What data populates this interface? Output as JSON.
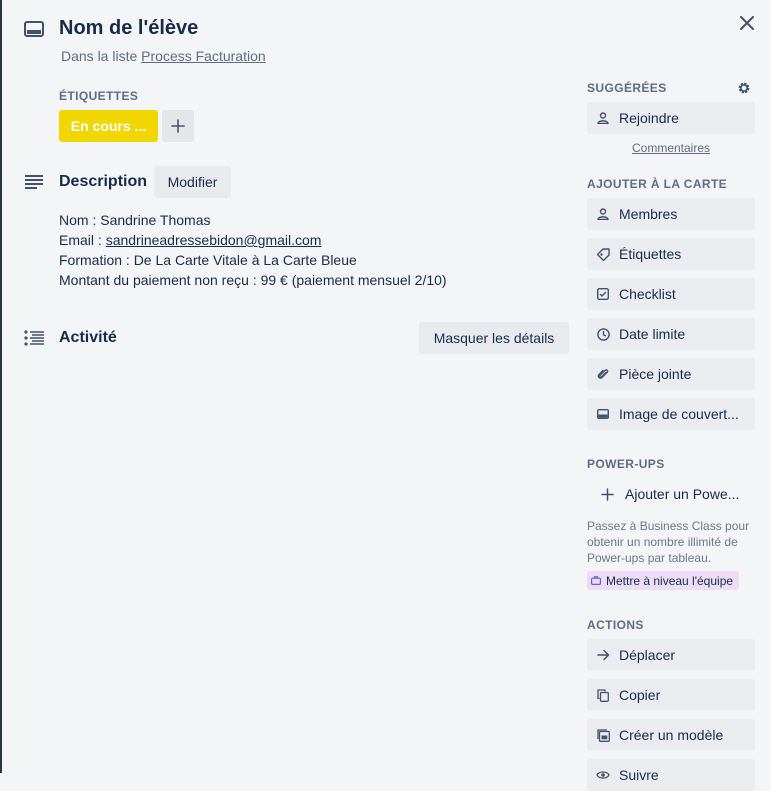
{
  "card": {
    "title": "Nom de l'élève",
    "in_list_prefix": "Dans la liste",
    "list_name": "Process Facturation"
  },
  "labels": {
    "heading": "Étiquettes",
    "chip": "En cours ...",
    "chip_color": "#f2d600"
  },
  "description": {
    "heading": "Description",
    "edit_label": "Modifier",
    "name_line": "Nom : Sandrine Thomas",
    "email_prefix": "Email : ",
    "email": "sandrineadressebidon@gmail.com",
    "formation_line": "Formation : De La Carte Vitale à La Carte Bleue",
    "amount_line": "Montant du paiement non reçu : 99 € (paiement mensuel 2/10)"
  },
  "activity": {
    "heading": "Activité",
    "hide_details_label": "Masquer les détails"
  },
  "sidebar": {
    "suggested": {
      "heading": "Suggérées",
      "join_label": "Rejoindre",
      "comments_link": "Commentaires"
    },
    "add_to_card": {
      "heading": "Ajouter à la carte",
      "items": [
        {
          "label": "Membres",
          "icon": "person-icon"
        },
        {
          "label": "Étiquettes",
          "icon": "tag-icon"
        },
        {
          "label": "Checklist",
          "icon": "checklist-icon"
        },
        {
          "label": "Date limite",
          "icon": "clock-icon"
        },
        {
          "label": "Pièce jointe",
          "icon": "paperclip-icon"
        },
        {
          "label": "Image de couvert...",
          "icon": "cover-icon"
        }
      ]
    },
    "power_ups": {
      "heading": "Power-Ups",
      "add_label": "Ajouter un Powe...",
      "note": "Passez à Business Class pour obtenir un nombre illimité de Power-ups par tableau.",
      "upgrade_label": "Mettre à niveau l'équipe",
      "upgrade_color": "#eddcf5"
    },
    "actions": {
      "heading": "Actions",
      "items": [
        {
          "label": "Déplacer",
          "icon": "arrow-right-icon"
        },
        {
          "label": "Copier",
          "icon": "copy-icon"
        },
        {
          "label": "Créer un modèle",
          "icon": "template-icon"
        },
        {
          "label": "Suivre",
          "icon": "eye-icon"
        }
      ]
    }
  }
}
